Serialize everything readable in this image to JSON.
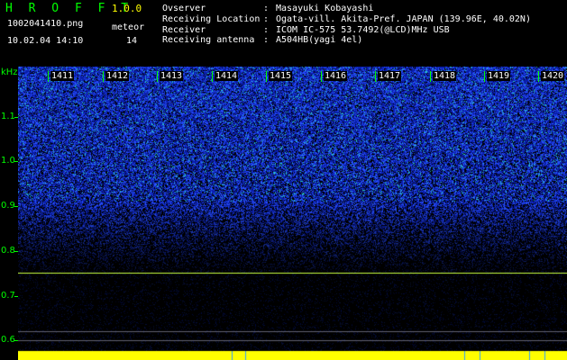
{
  "header": {
    "app_title": "H R O F F T",
    "app_version": "1.0.0",
    "file_name": "1002041410.png",
    "datetime": "10.02.04 14:10",
    "meteor_label": "meteor",
    "meteor_count": "14"
  },
  "info": [
    {
      "key": "Ovserver",
      "sep": ":",
      "value": "Masayuki Kobayashi"
    },
    {
      "key": "Receiving Location",
      "sep": ":",
      "value": "Ogata-vill. Akita-Pref. JAPAN (139.96E, 40.02N)"
    },
    {
      "key": "Receiver",
      "sep": ":",
      "value": "ICOM IC-575 53.7492(@LCD)MHz USB"
    },
    {
      "key": "Receiving antenna",
      "sep": ":",
      "value": "A504HB(yagi 4el)"
    }
  ],
  "plot": {
    "y_unit": "kHz",
    "y_ticks": [
      "1.1",
      "1.0",
      "0.9",
      "0.8",
      "0.7",
      "0.6"
    ],
    "minutes": [
      "1411",
      "1412",
      "1413",
      "1414",
      "1415",
      "1416",
      "1417",
      "1418",
      "1419",
      "1420"
    ],
    "colors": {
      "accent": "#00ff00",
      "noise_high": "#3f6fff",
      "noise_low": "#001060",
      "line": "#c8ff40",
      "bottom_bar": "#ffff00"
    }
  }
}
